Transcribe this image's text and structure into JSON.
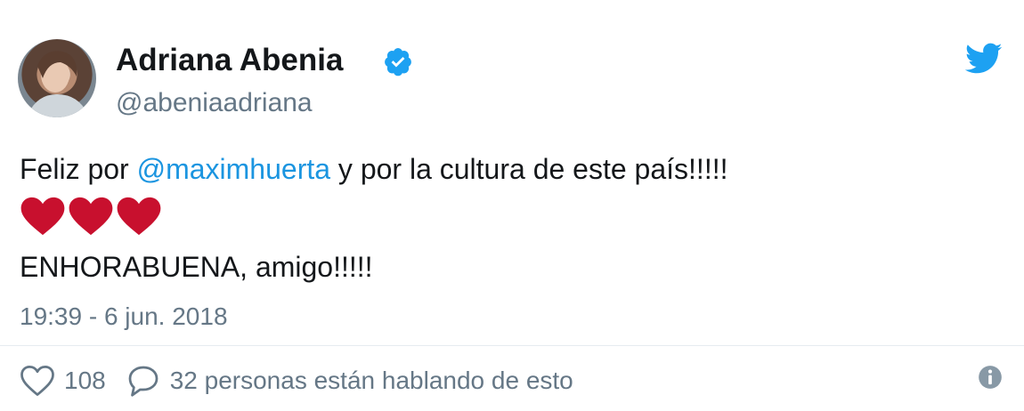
{
  "author": {
    "name": "Adriana Abenia",
    "handle": "@abeniaadriana",
    "verified": true
  },
  "tweet": {
    "text_before": "Feliz por ",
    "mention": "@maximhuerta",
    "text_after": " y por la cultura de este país!!!!!",
    "emoji": [
      "red-heart",
      "red-heart",
      "red-heart"
    ],
    "line2": "ENHORABUENA, amigo!!!!!",
    "timestamp": "19:39 - 6 jun. 2018"
  },
  "stats": {
    "likes": "108",
    "conversation": "32 personas están hablando de esto"
  },
  "colors": {
    "mention": "#1b95e0",
    "secondary_text": "#657786",
    "twitter_blue": "#1da1f2",
    "heart_red": "#c8102e"
  },
  "icons": {
    "verified": "verified-badge-icon",
    "brand": "twitter-bird-icon",
    "like": "heart-outline-icon",
    "reply": "speech-bubble-icon",
    "info": "info-icon"
  }
}
